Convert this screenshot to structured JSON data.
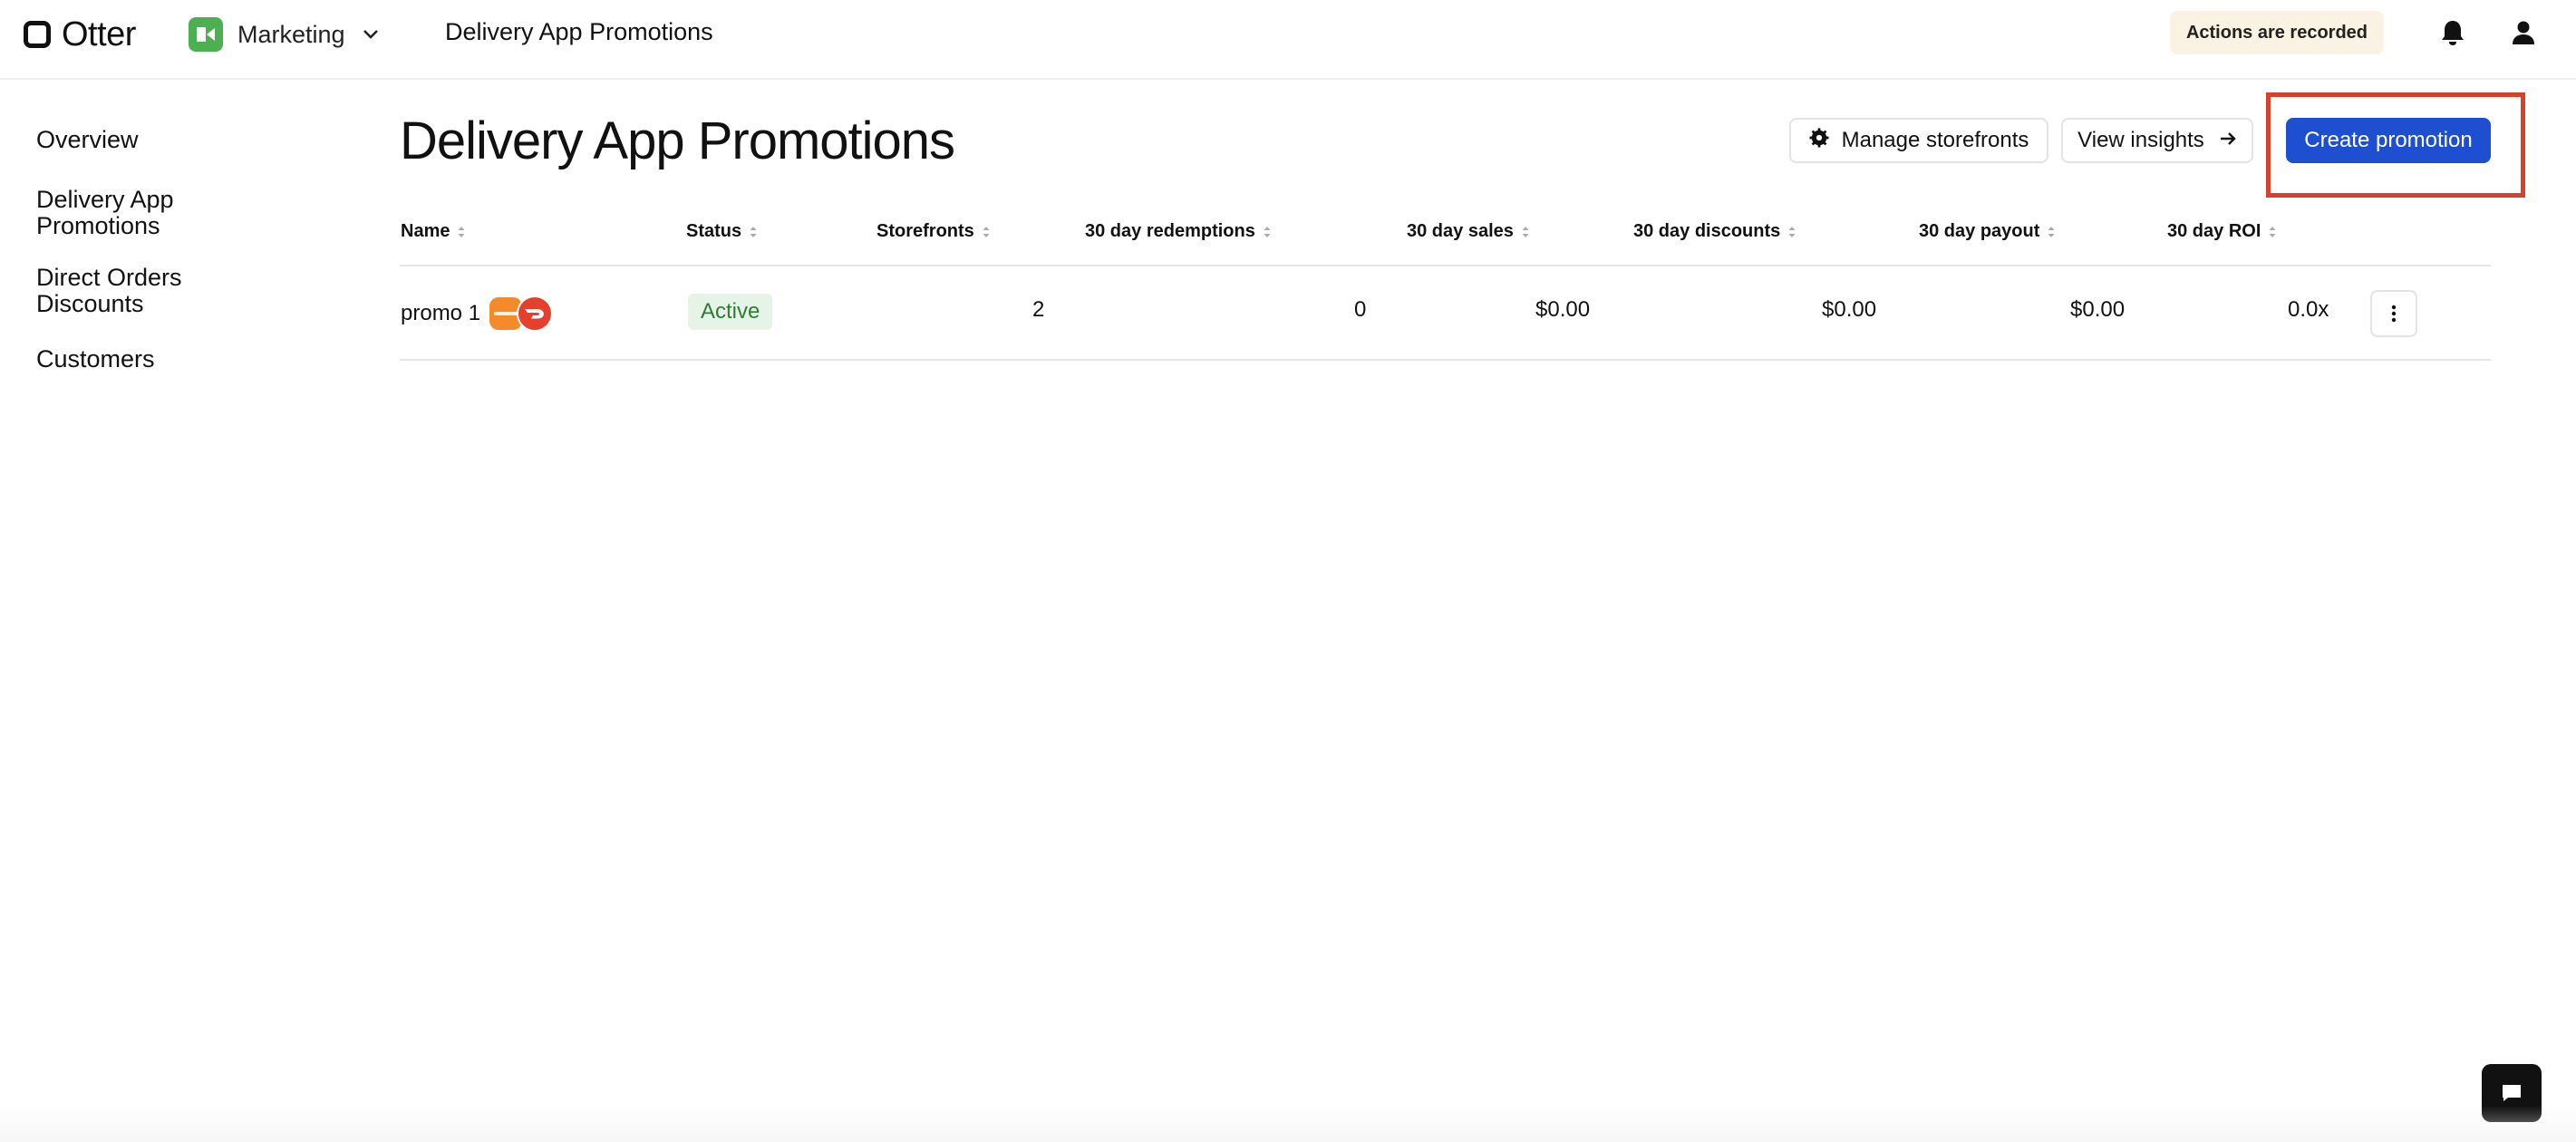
{
  "topbar": {
    "logo_text": "Otter",
    "workspace_label": "Marketing",
    "page_title": "Delivery App Promotions",
    "recorded_badge": "Actions are recorded"
  },
  "sidebar": {
    "items": [
      {
        "label": "Overview"
      },
      {
        "label_line1": "Delivery App",
        "label_line2": "Promotions"
      },
      {
        "label_line1": "Direct Orders",
        "label_line2": "Discounts"
      },
      {
        "label": "Customers"
      }
    ]
  },
  "main": {
    "title": "Delivery App Promotions",
    "buttons": {
      "manage_storefronts": "Manage storefronts",
      "view_insights": "View insights",
      "create_promotion": "Create promotion"
    }
  },
  "table": {
    "columns": [
      "Name",
      "Status",
      "Storefronts",
      "30 day redemptions",
      "30 day sales",
      "30 day discounts",
      "30 day payout",
      "30 day ROI"
    ],
    "rows": [
      {
        "name": "promo 1",
        "status": "Active",
        "storefronts": "2",
        "redemptions": "0",
        "sales": "$0.00",
        "discounts": "$0.00",
        "payout": "$0.00",
        "roi": "0.0x"
      }
    ]
  },
  "colors": {
    "primary": "#1f4fd1",
    "highlight": "#d9402c",
    "active_bg": "#e6f4e7",
    "active_text": "#2e7d32",
    "recorded_bg": "#faf3e3",
    "workspace_icon": "#4caf50"
  },
  "icons": [
    "otter-logo-icon",
    "marketing-workspace-icon",
    "chevron-down-icon",
    "bell-icon",
    "user-icon",
    "gear-icon",
    "arrow-right-icon",
    "sort-icon",
    "kebab-menu-icon",
    "chat-icon",
    "grubhub-logo-icon",
    "doordash-logo-icon"
  ]
}
